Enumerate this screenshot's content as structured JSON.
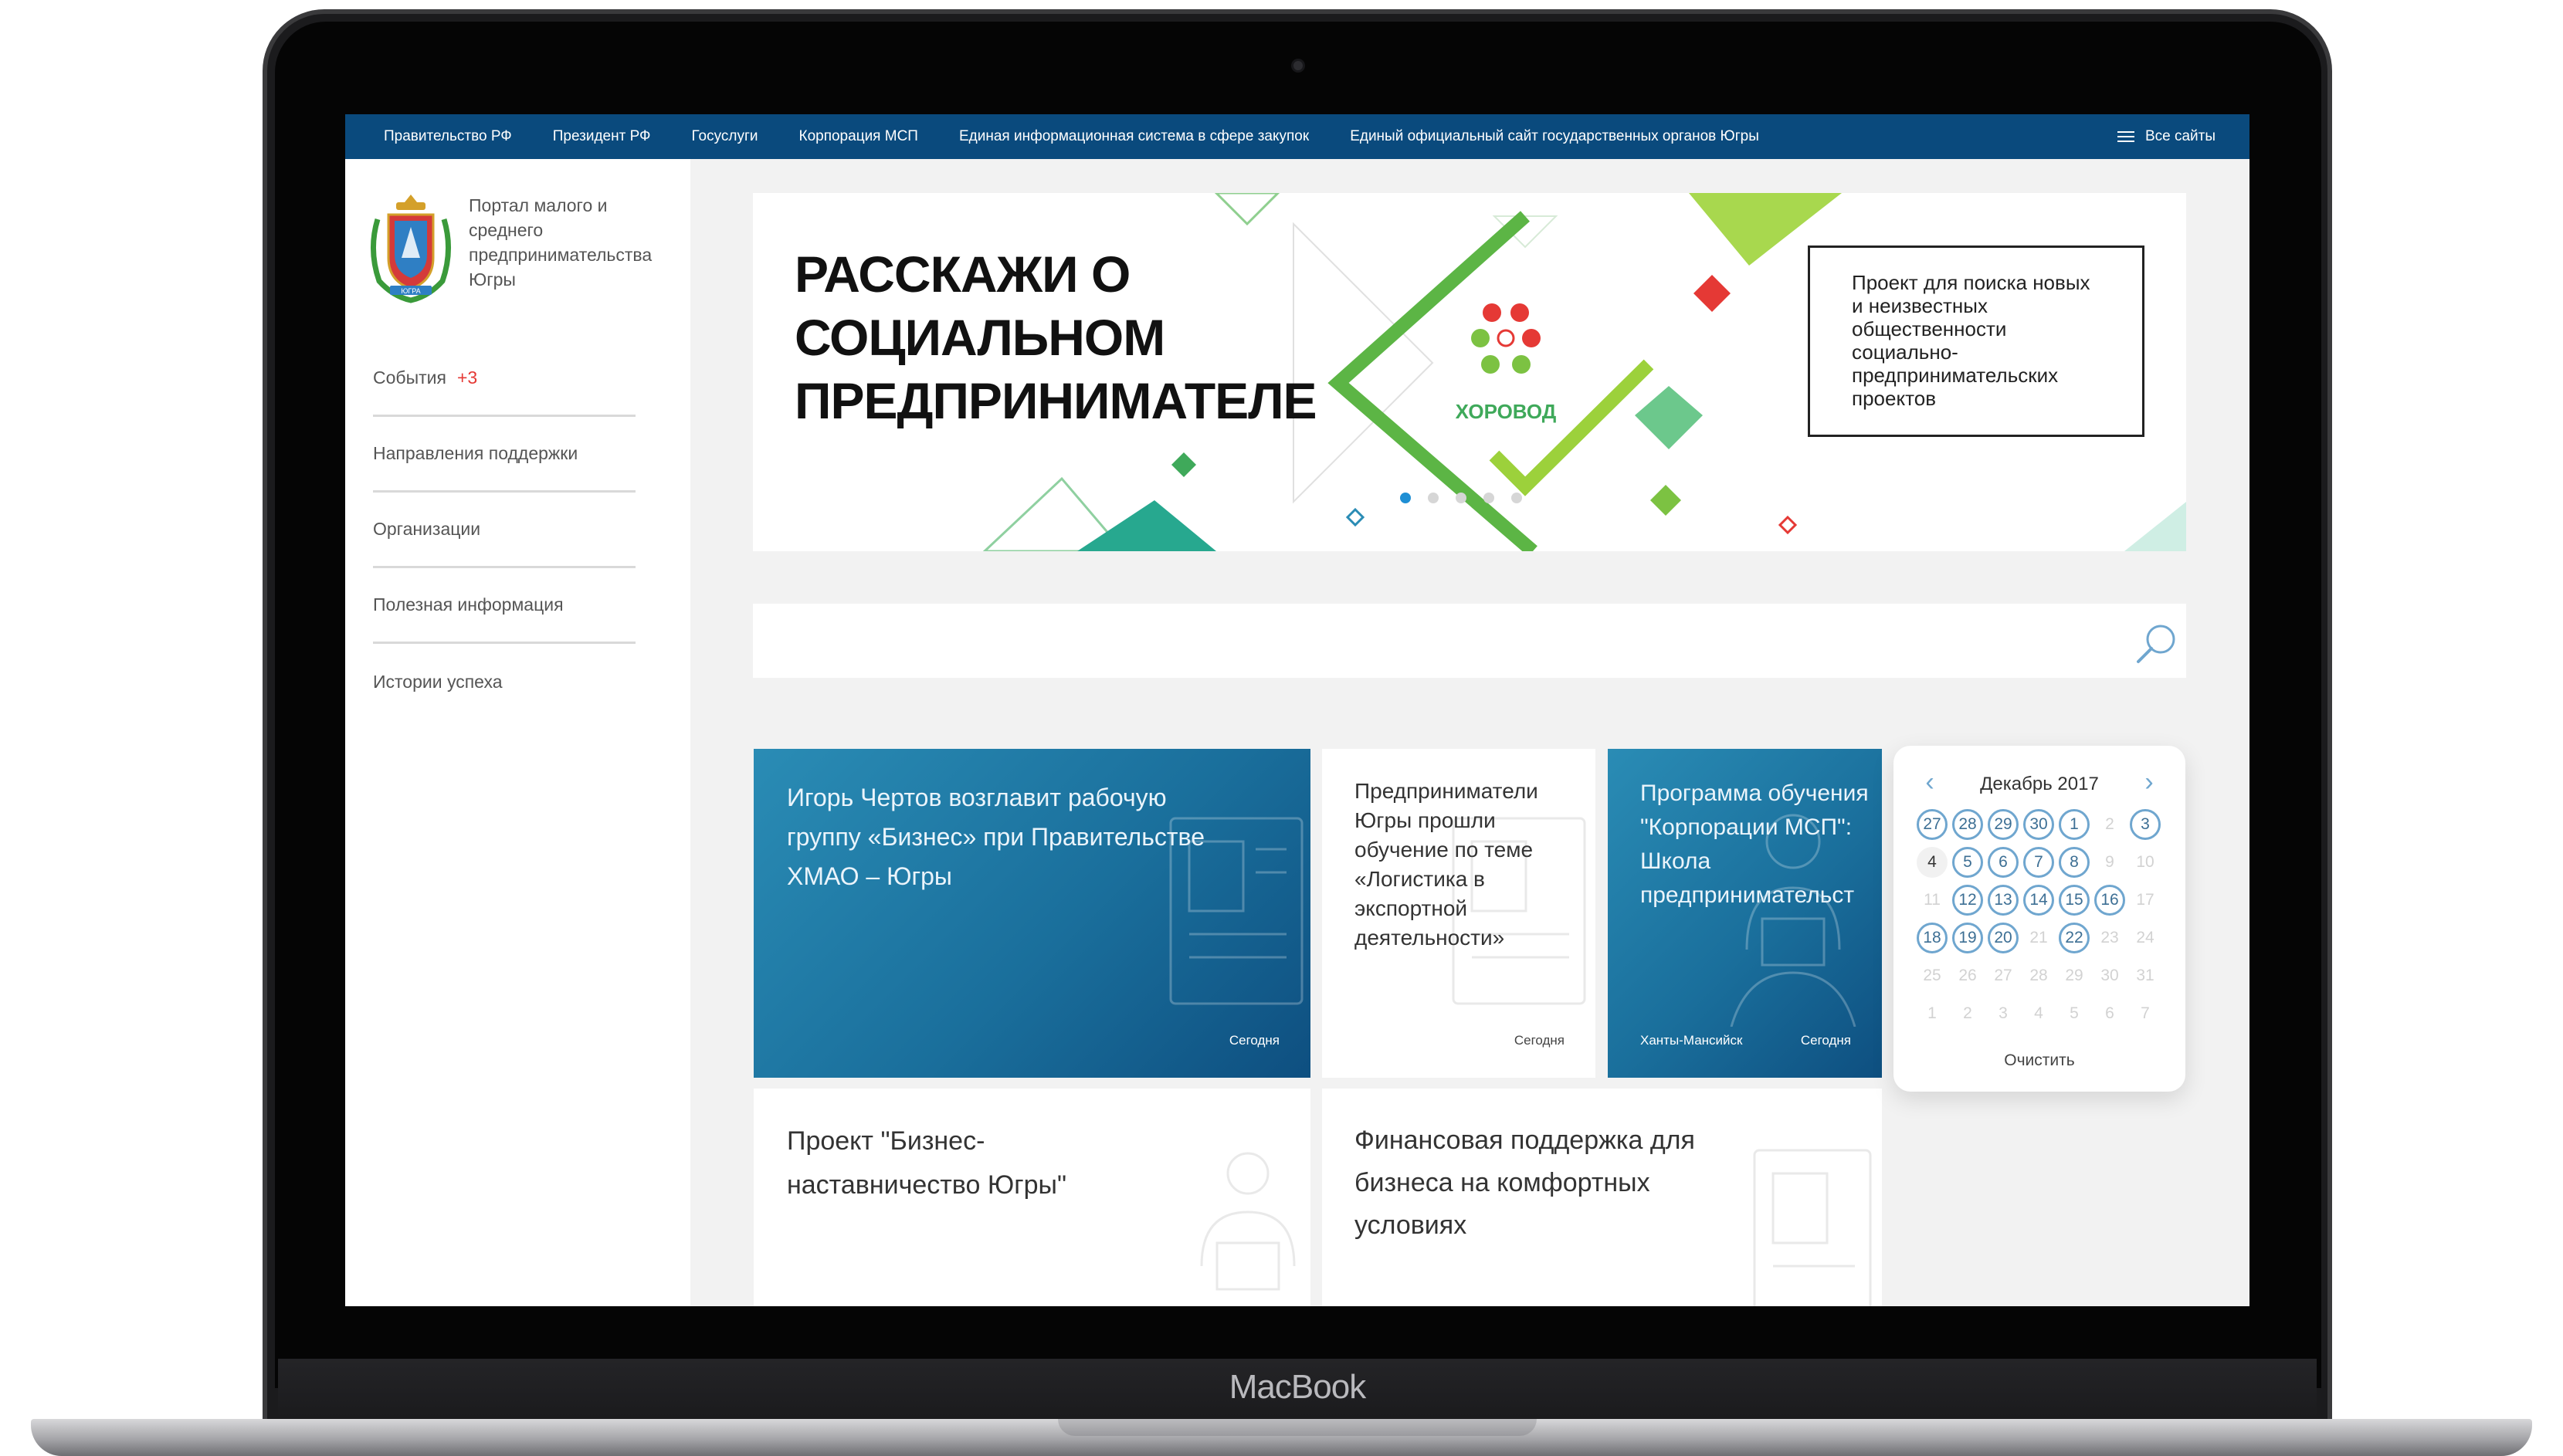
{
  "device": {
    "brand": "MacBook"
  },
  "topbar": {
    "links": [
      "Правительство РФ",
      "Президент РФ",
      "Госуслуги",
      "Корпорация МСП",
      "Единая информационная система в сфере закупок",
      "Единый официальный сайт государственных органов Югры"
    ],
    "all_sites": "Все сайты"
  },
  "sidebar": {
    "portal_name": "Портал малого и среднего предпринимательства Югры",
    "logo_text": "ЮГРА",
    "nav": [
      {
        "label": "События",
        "badge": "+3"
      },
      {
        "label": "Направления поддержки"
      },
      {
        "label": "Организации"
      },
      {
        "label": "Полезная информация"
      },
      {
        "label": "Истории успеха"
      }
    ]
  },
  "banner": {
    "title": "РАССКАЖИ О СОЦИАЛЬНОМ ПРЕДПРИНИМАТЕЛЕ",
    "logo_text": "ХОРОВОД",
    "description": "Проект для поиска новых и неизвестных общественности социально-предпринимательских проектов",
    "active_slide": 1,
    "slide_count": 5
  },
  "search": {
    "placeholder": ""
  },
  "cards": [
    {
      "title": "Игорь Чертов возглавит рабочую группу «Бизнес» при Правительстве ХМАО – Югры",
      "date": "Сегодня",
      "location": ""
    },
    {
      "title": "Предприниматели Югры прошли обучение по теме «Логистика в экспортной деятельности»",
      "date": "Сегодня",
      "location": ""
    },
    {
      "title": "Программа обучения \"Корпорации МСП\": Школа предпринимательст",
      "date": "Сегодня",
      "location": "Ханты-Мансийск"
    },
    {
      "title": "Проект \"Бизнес-наставничество Югры\"",
      "date": "",
      "location": ""
    },
    {
      "title": "Финансовая поддержка для бизнеса на комфортных условиях",
      "date": "",
      "location": ""
    }
  ],
  "calendar": {
    "month": "Декабрь 2017",
    "prev": "‹",
    "next": "›",
    "clear": "Очистить",
    "days": [
      {
        "d": "27",
        "s": "ring"
      },
      {
        "d": "28",
        "s": "ring"
      },
      {
        "d": "29",
        "s": "ring"
      },
      {
        "d": "30",
        "s": "ring"
      },
      {
        "d": "1",
        "s": "ring"
      },
      {
        "d": "2",
        "s": "muted"
      },
      {
        "d": "3",
        "s": "ring"
      },
      {
        "d": "4",
        "s": "today"
      },
      {
        "d": "5",
        "s": "ring"
      },
      {
        "d": "6",
        "s": "ring"
      },
      {
        "d": "7",
        "s": "ring"
      },
      {
        "d": "8",
        "s": "ring"
      },
      {
        "d": "9",
        "s": "muted"
      },
      {
        "d": "10",
        "s": "muted"
      },
      {
        "d": "11",
        "s": "muted"
      },
      {
        "d": "12",
        "s": "ring"
      },
      {
        "d": "13",
        "s": "ring"
      },
      {
        "d": "14",
        "s": "ring"
      },
      {
        "d": "15",
        "s": "ring"
      },
      {
        "d": "16",
        "s": "ring"
      },
      {
        "d": "17",
        "s": "muted"
      },
      {
        "d": "18",
        "s": "ring"
      },
      {
        "d": "19",
        "s": "ring"
      },
      {
        "d": "20",
        "s": "ring"
      },
      {
        "d": "21",
        "s": "muted"
      },
      {
        "d": "22",
        "s": "ring"
      },
      {
        "d": "23",
        "s": "muted"
      },
      {
        "d": "24",
        "s": "muted"
      },
      {
        "d": "25",
        "s": "muted"
      },
      {
        "d": "26",
        "s": "muted"
      },
      {
        "d": "27",
        "s": "muted"
      },
      {
        "d": "28",
        "s": "muted"
      },
      {
        "d": "29",
        "s": "muted"
      },
      {
        "d": "30",
        "s": "muted"
      },
      {
        "d": "31",
        "s": "muted"
      },
      {
        "d": "1",
        "s": "muted"
      },
      {
        "d": "2",
        "s": "muted"
      },
      {
        "d": "3",
        "s": "muted"
      },
      {
        "d": "4",
        "s": "muted"
      },
      {
        "d": "5",
        "s": "muted"
      },
      {
        "d": "6",
        "s": "muted"
      },
      {
        "d": "7",
        "s": "muted"
      }
    ]
  },
  "colors": {
    "topbar": "#0a4a7d",
    "accent": "#1f8fd4",
    "badge": "#e53935",
    "banner_green": "#7cc242"
  }
}
